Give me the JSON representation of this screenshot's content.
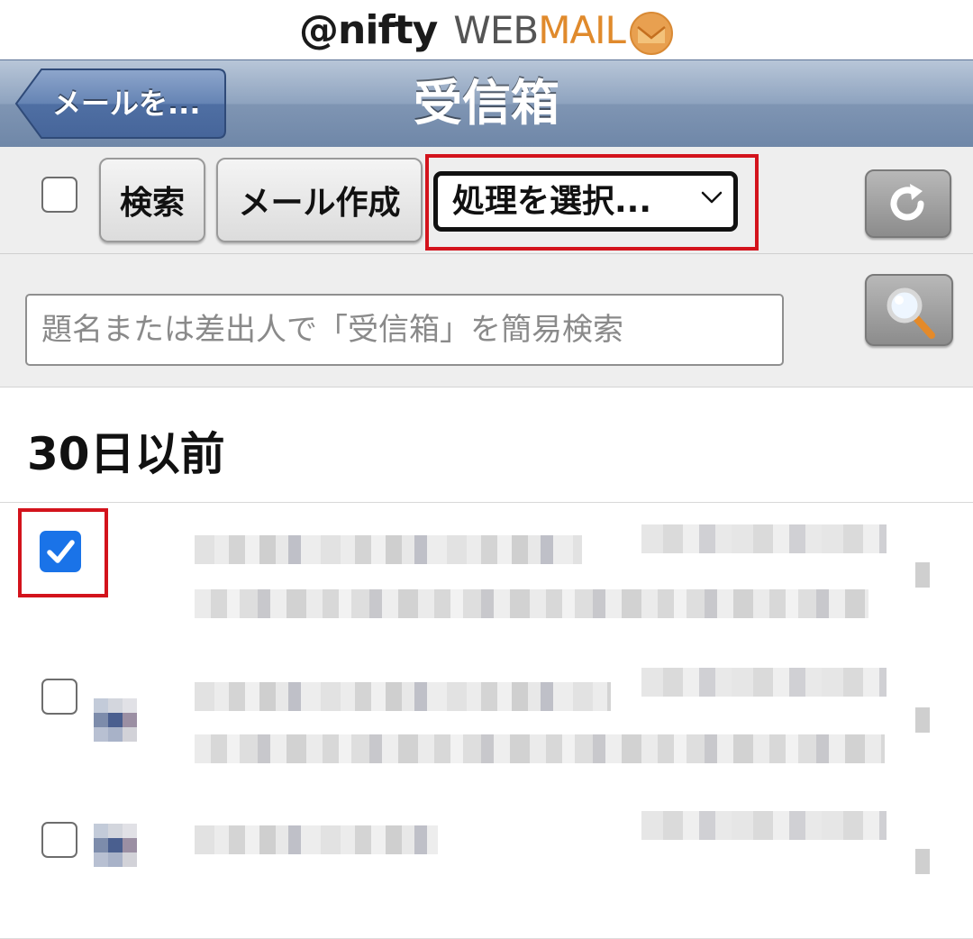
{
  "logo": {
    "brand": "@nifty",
    "web": "WEB",
    "mail": "MAIL"
  },
  "nav": {
    "back_label": "メールを...",
    "title": "受信箱"
  },
  "toolbar": {
    "search_label": "検索",
    "compose_label": "メール作成",
    "action_select_value": "処理を選択..."
  },
  "search": {
    "placeholder": "題名または差出人で「受信箱」を簡易検索"
  },
  "section": {
    "title": "30日以前"
  },
  "mails": [
    {
      "checked": true
    },
    {
      "checked": false
    },
    {
      "checked": false
    }
  ],
  "colors": {
    "nav_bar": "#8ea3bf",
    "back_button": "#5c7aa8",
    "highlight": "#d3131c",
    "checkbox_checked": "#1a73e8",
    "logo_mail": "#e08a2c"
  },
  "icons": {
    "back": "left-arrow-button-shape",
    "select_caret": "chevron-down-icon",
    "refresh": "refresh-icon",
    "magnifier": "search-icon",
    "check": "checkmark-icon"
  }
}
